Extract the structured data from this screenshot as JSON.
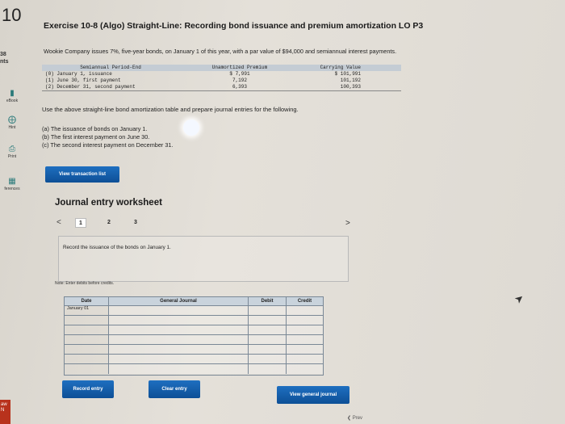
{
  "question": {
    "number": "10"
  },
  "sidebar": {
    "points": "38",
    "points_label": "nts",
    "tools": [
      {
        "label": "eBook",
        "icon": "book-icon"
      },
      {
        "label": "Hint",
        "icon": "hint-icon"
      },
      {
        "label": "Print",
        "icon": "print-icon"
      },
      {
        "label": "ferences",
        "icon": "references-icon"
      }
    ],
    "flag_text": "aw\nN"
  },
  "exercise": {
    "title": "Exercise 10-8 (Algo) Straight-Line: Recording bond issuance and premium amortization LO P3",
    "intro": "Wookie Company issues 7%, five-year bonds, on January 1 of this year, with a par value of $94,000 and semiannual interest payments."
  },
  "amortization_table": {
    "headers": [
      "Semiannual Period-End",
      "Unamortized Premium",
      "Carrying Value"
    ],
    "rows": [
      {
        "period": "(0)  January 1, issuance",
        "premium": "$ 7,991",
        "carrying": "$ 101,991"
      },
      {
        "period": "(1)  June 30, first payment",
        "premium": "7,192",
        "carrying": "101,192"
      },
      {
        "period": "(2)  December 31, second payment",
        "premium": "6,393",
        "carrying": "100,393"
      }
    ]
  },
  "instruction": "Use the above straight-line bond amortization table and prepare journal entries for the following.",
  "parts": [
    "(a) The issuance of bonds on January 1.",
    "(b) The first interest payment on June 30.",
    "(c) The second interest payment on December 31."
  ],
  "buttons": {
    "view_transaction_list": "View transaction list",
    "record_entry": "Record entry",
    "clear_entry": "Clear entry",
    "view_general_journal": "View general journal"
  },
  "worksheet": {
    "title": "Journal entry worksheet",
    "pages": [
      "1",
      "2",
      "3"
    ],
    "active_page": "1",
    "prev_glyph": "<",
    "next_glyph": ">",
    "prompt": "Record the issuance of the bonds on January 1.",
    "note": "Note: Enter debits before credits.",
    "columns": [
      "Date",
      "General Journal",
      "Debit",
      "Credit"
    ],
    "rows": [
      {
        "date": "January 01",
        "account": "",
        "debit": "",
        "credit": ""
      },
      {
        "date": "",
        "account": "",
        "debit": "",
        "credit": ""
      },
      {
        "date": "",
        "account": "",
        "debit": "",
        "credit": ""
      },
      {
        "date": "",
        "account": "",
        "debit": "",
        "credit": ""
      },
      {
        "date": "",
        "account": "",
        "debit": "",
        "credit": ""
      },
      {
        "date": "",
        "account": "",
        "debit": "",
        "credit": ""
      },
      {
        "date": "",
        "account": "",
        "debit": "",
        "credit": ""
      }
    ]
  },
  "footer": {
    "prev_label": "Prev"
  },
  "colors": {
    "button_blue": "#1466b8",
    "header_fill": "#c9d3dc",
    "table_header_fill": "#c4ccd4"
  }
}
